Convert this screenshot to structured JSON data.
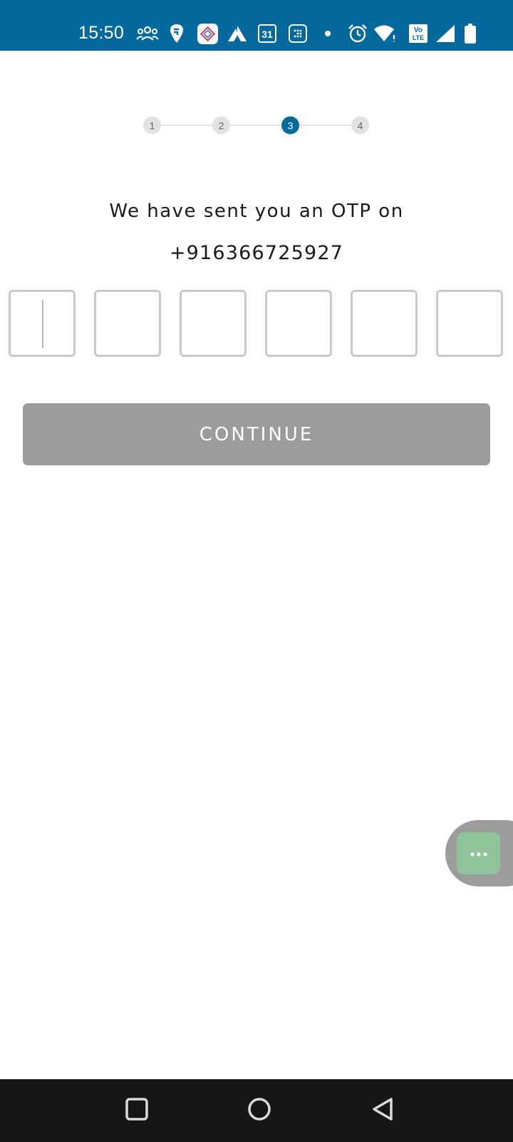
{
  "status_bar": {
    "time": "15:50",
    "icons": [
      "groups-icon",
      "swiggy-icon",
      "app-notification-icon",
      "axis-icon",
      "calendar-icon",
      "dialpad-icon",
      "dot-icon",
      "alarm-icon",
      "wifi-icon",
      "volte-icon",
      "signal-icon",
      "battery-icon"
    ],
    "calendar_day": "31",
    "volte_label_top": "Vo",
    "volte_label_bottom": "LTE"
  },
  "stepper": {
    "steps": [
      "1",
      "2",
      "3",
      "4"
    ],
    "active_step": "3"
  },
  "otp": {
    "message": "We have sent you an OTP on",
    "phone": "+916366725927",
    "digits": [
      "",
      "",
      "",
      "",
      "",
      ""
    ]
  },
  "continue_button": {
    "label": "CONTINUE"
  },
  "chat_widget": {
    "icon": "chat-dots-icon"
  },
  "nav_bar": {
    "icons": [
      "recents-icon",
      "home-icon",
      "back-icon"
    ]
  },
  "colors": {
    "accent": "#06699e",
    "disabled_button": "#9c9c9c",
    "chat_fab": "#8fc49a",
    "nav_bar": "#161616"
  }
}
